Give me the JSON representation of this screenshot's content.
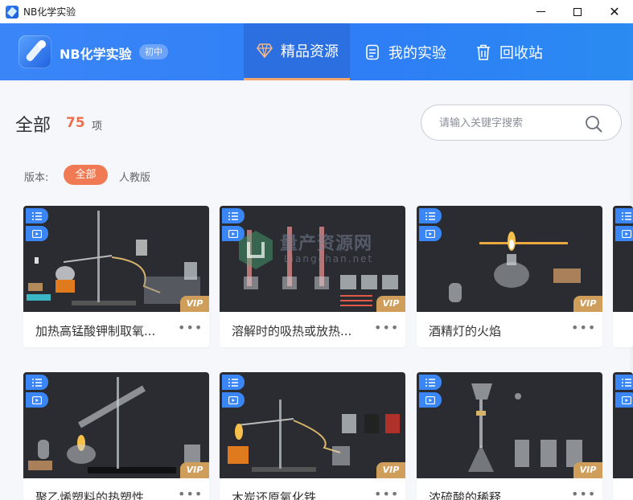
{
  "window": {
    "title": "NB化学实验"
  },
  "header": {
    "brand": "NB化学实验",
    "grade": "初中",
    "tabs": [
      {
        "label": "精品资源",
        "icon": "diamond-icon",
        "active": true
      },
      {
        "label": "我的实验",
        "icon": "notebook-icon",
        "active": false
      },
      {
        "label": "回收站",
        "icon": "trash-icon",
        "active": false
      }
    ]
  },
  "main": {
    "heading": "全部",
    "count": "75",
    "count_unit": "项",
    "search_placeholder": "请输入关键字搜索",
    "edition_label": "版本:",
    "filters": [
      "全部",
      "人教版"
    ]
  },
  "watermark": {
    "cn": "量产资源网",
    "en": "Liangchan.net"
  },
  "cards": [
    {
      "title": "加热高锰酸钾制取氧...",
      "vip": "VIP"
    },
    {
      "title": "溶解时的吸热或放热...",
      "vip": "VIP"
    },
    {
      "title": "酒精灯的火焰",
      "vip": "VIP"
    },
    {
      "title": "聚乙烯塑料的热塑性",
      "vip": "VIP"
    },
    {
      "title": "木炭还原氧化铁",
      "vip": "VIP"
    },
    {
      "title": "浓硫酸的稀释",
      "vip": "VIP"
    }
  ],
  "colors": {
    "accent": "#3a86f8",
    "highlight": "#f07a53",
    "vip": "#cf9e5b"
  }
}
